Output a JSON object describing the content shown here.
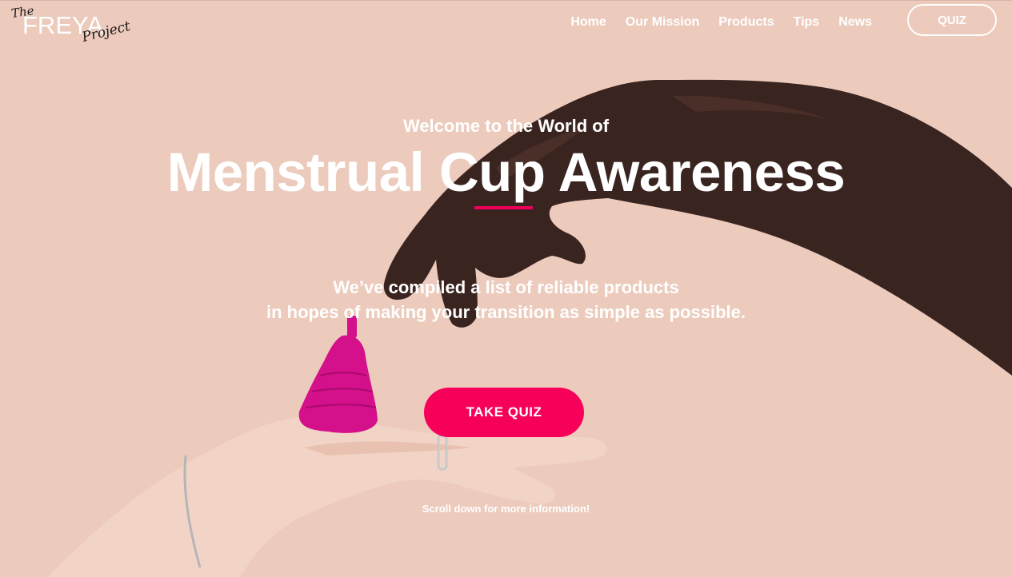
{
  "logo": {
    "the": "The",
    "main": "FREYA",
    "project": "Project"
  },
  "nav": {
    "items": [
      "Home",
      "Our Mission",
      "Products",
      "Tips",
      "News"
    ],
    "quiz_label": "QUIZ"
  },
  "hero": {
    "kicker": "Welcome to the World of",
    "title": "Menstrual Cup Awareness",
    "subtitle_line1": "We’ve compiled a list of reliable products",
    "subtitle_line2": "in hopes of making your transition as simple as possible.",
    "cta_label": "TAKE QUIZ",
    "scroll_hint": "Scroll down for more information!"
  },
  "colors": {
    "background": "#eccbbd",
    "accent": "#f7005a",
    "text": "#ffffff",
    "cup": "#d4108a"
  }
}
